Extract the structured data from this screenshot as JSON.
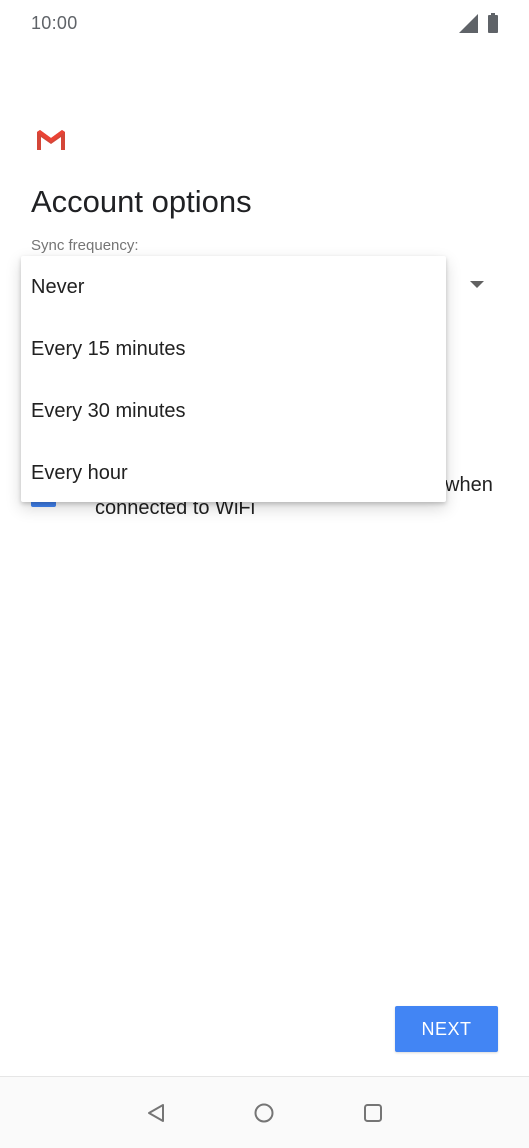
{
  "status_bar": {
    "time": "10:00",
    "icons": [
      "signal-icon",
      "battery-icon"
    ]
  },
  "app": {
    "logo_icon": "gmail-icon",
    "brand_color": "#D44638"
  },
  "page": {
    "title": "Account options",
    "sync_label": "Sync frequency:"
  },
  "dropdown": {
    "options": [
      {
        "label": "Never"
      },
      {
        "label": "Every 15 minutes"
      },
      {
        "label": "Every 30 minutes"
      },
      {
        "label": "Every hour"
      }
    ],
    "arrow_icon": "chevron-down-icon"
  },
  "wifi_checkbox": {
    "checked": true,
    "label_visible_end": "when",
    "label_line2": "connected to WiFi",
    "accent": "#4285F4"
  },
  "footer": {
    "next_label": "NEXT",
    "button_color": "#4285F4"
  },
  "nav_bar": {
    "icons": [
      "back-icon",
      "home-icon",
      "recents-icon"
    ]
  }
}
